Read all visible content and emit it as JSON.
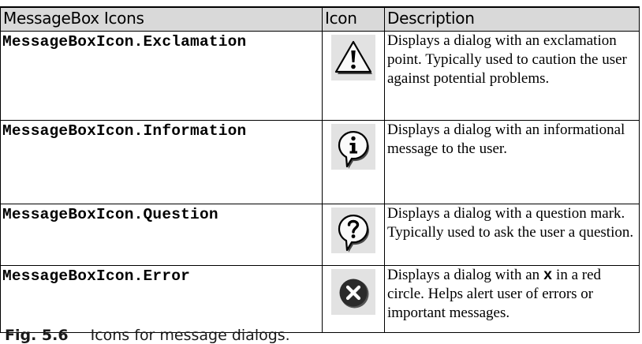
{
  "table": {
    "headers": [
      "MessageBox Icons",
      "Icon",
      "Description"
    ],
    "rows": [
      {
        "name": "MessageBoxIcon.Exclamation",
        "icon": "exclamation-icon",
        "description": "Displays a dialog with an exclamation point. Typically used to caution the user against potential problems."
      },
      {
        "name": "MessageBoxIcon.Information",
        "icon": "information-icon",
        "description": "Displays a dialog with an informational message to the user."
      },
      {
        "name": "MessageBoxIcon.Question",
        "icon": "question-icon",
        "description": "Displays a dialog with a question mark. Typically used to ask the user a question."
      },
      {
        "name": "MessageBoxIcon.Error",
        "icon": "error-icon",
        "description_before": "Displays a dialog with an ",
        "description_code": "x",
        "description_after": " in a red circle. Helps alert user of errors or important messages."
      }
    ]
  },
  "caption": {
    "label": "Fig. 5.6",
    "text": "Icons for message dialogs."
  }
}
